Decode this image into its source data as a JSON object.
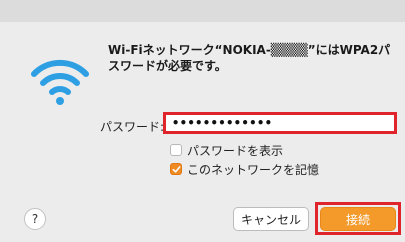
{
  "dialog": {
    "message": "Wi-Fiネットワーク“NOKIA-▒▒▒▒”にはWPA2パスワードが必要です。",
    "password_label": "パスワード:",
    "password_value": "•••••••••••••",
    "show_password_label": "パスワードを表示",
    "show_password_checked": false,
    "remember_network_label": "このネットワークを記憶",
    "remember_network_checked": true,
    "help_label": "?",
    "cancel_label": "キャンセル",
    "ok_label": "接続"
  },
  "colors": {
    "accent": "#f39a2b",
    "highlight": "#e0242b",
    "wifi_icon": "#2f9fe3"
  },
  "icons": {
    "network": "wifi-icon",
    "checkbox_checked": "checkmark-icon"
  }
}
